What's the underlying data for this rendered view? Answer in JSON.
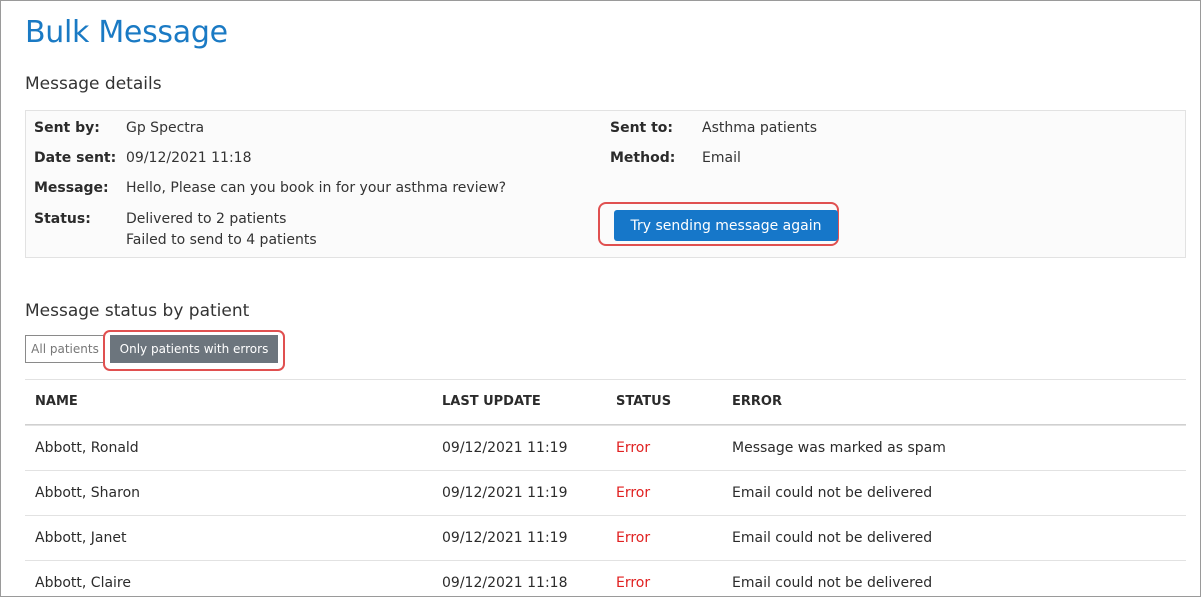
{
  "page": {
    "title": "Bulk Message"
  },
  "details": {
    "section_title": "Message details",
    "sent_by": {
      "label": "Sent by:",
      "value": "Gp Spectra"
    },
    "date_sent": {
      "label": "Date sent:",
      "value": "09/12/2021 11:18"
    },
    "message": {
      "label": "Message:",
      "value": "Hello, Please can you book in for your asthma review?"
    },
    "status": {
      "label": "Status:",
      "delivered": "Delivered to 2 patients",
      "failed": "Failed to send to 4 patients"
    },
    "sent_to": {
      "label": "Sent to:",
      "value": "Asthma patients"
    },
    "method": {
      "label": "Method:",
      "value": "Email"
    },
    "retry_button": "Try sending message again"
  },
  "status_by_patient": {
    "section_title": "Message status by patient",
    "filters": {
      "all": "All patients",
      "errors_only": "Only patients with errors"
    },
    "columns": [
      "NAME",
      "LAST UPDATE",
      "STATUS",
      "ERROR"
    ],
    "rows": [
      {
        "name": "Abbott, Ronald",
        "last_update": "09/12/2021 11:19",
        "status": "Error",
        "error": "Message was marked as spam"
      },
      {
        "name": "Abbott, Sharon",
        "last_update": "09/12/2021 11:19",
        "status": "Error",
        "error": "Email could not be delivered"
      },
      {
        "name": "Abbott, Janet",
        "last_update": "09/12/2021 11:19",
        "status": "Error",
        "error": "Email could not be delivered"
      },
      {
        "name": "Abbott, Claire",
        "last_update": "09/12/2021 11:18",
        "status": "Error",
        "error": "Email could not be delivered"
      }
    ]
  },
  "colors": {
    "accent": "#1a7ac4",
    "button": "#1677c9",
    "error": "#e02020",
    "filter_active": "#6c757d",
    "highlight": "#e05050"
  }
}
